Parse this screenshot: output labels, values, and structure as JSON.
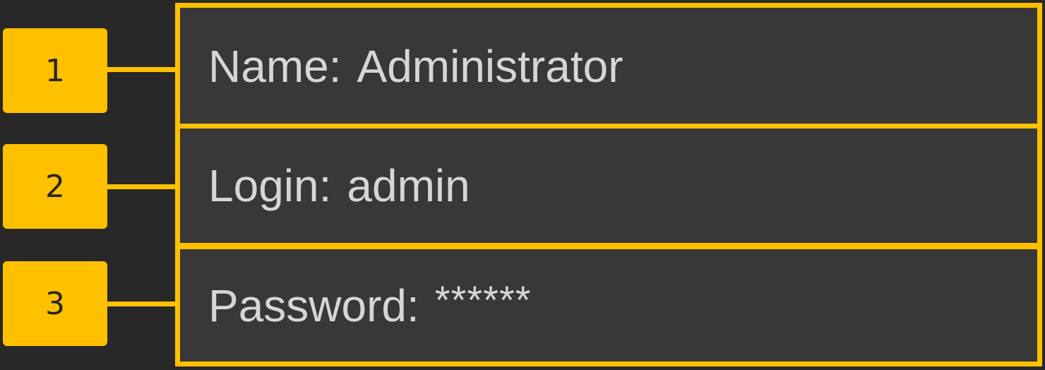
{
  "callouts": [
    "1",
    "2",
    "3"
  ],
  "fields": {
    "name": {
      "label": "Name:",
      "value": "Administrator"
    },
    "login": {
      "label": "Login:",
      "value": "admin"
    },
    "password": {
      "label": "Password:",
      "value": "******"
    }
  },
  "colors": {
    "accent": "#ffc000",
    "background": "#282828",
    "panel": "#383838",
    "text": "#d6d6d6"
  }
}
